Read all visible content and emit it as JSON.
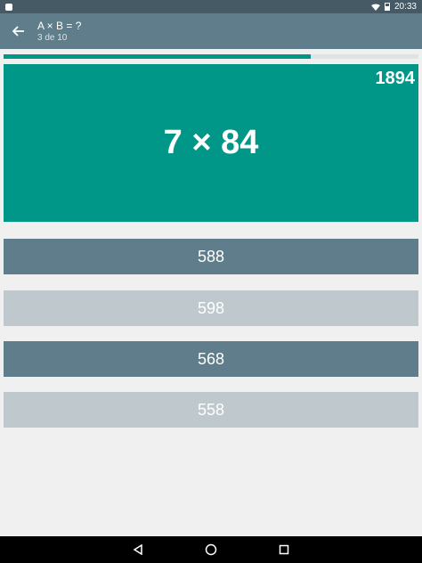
{
  "status_bar": {
    "time": "20:33",
    "icons": [
      "notification-icon",
      "wifi-icon",
      "battery-icon"
    ]
  },
  "toolbar": {
    "title": "A × B = ?",
    "subtitle": "3 de 10",
    "back_icon": "arrow-back-icon"
  },
  "progress": {
    "fraction": 0.74,
    "color": "#009688"
  },
  "question_card": {
    "score": "1894",
    "question": "7 × 84",
    "color": "#009688"
  },
  "answers": [
    {
      "label": "588",
      "style": "dark"
    },
    {
      "label": "598",
      "style": "light"
    },
    {
      "label": "568",
      "style": "dark"
    },
    {
      "label": "558",
      "style": "light"
    }
  ],
  "nav_bar": {
    "icons": [
      "back-triangle-icon",
      "home-circle-icon",
      "recents-square-icon"
    ]
  },
  "colors": {
    "toolbar": "#607d8b",
    "status_bar": "#455a64",
    "answer_dark": "#607d8b",
    "answer_light": "#bfc9cd"
  }
}
